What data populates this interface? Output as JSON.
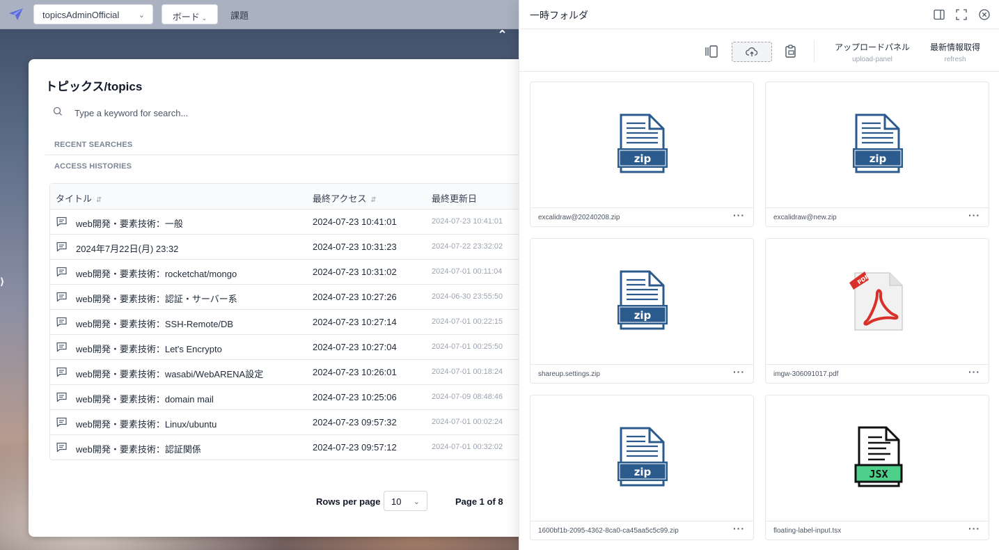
{
  "topbar": {
    "workspace": "topicsAdminOfficial",
    "board_label": "ボード",
    "task_label": "課題"
  },
  "topics": {
    "title": "トピックス/topics",
    "search_placeholder": "Type a keyword for search...",
    "recent_searches": "RECENT SEARCHES",
    "access_histories": "ACCESS HISTORIES",
    "columns": {
      "title": "タイトル",
      "last_access": "最終アクセス",
      "last_updated": "最終更新日"
    },
    "rows": [
      {
        "title": "web開発・要素技術：一般",
        "access": "2024-07-23 10:41:01",
        "updated": "2024-07-23 10:41:01"
      },
      {
        "title": "2024年7月22日(月) 23:32",
        "access": "2024-07-23 10:31:23",
        "updated": "2024-07-22 23:32:02"
      },
      {
        "title": "web開発・要素技術：rocketchat/mongo",
        "access": "2024-07-23 10:31:02",
        "updated": "2024-07-01 00:11:04"
      },
      {
        "title": "web開発・要素技術：認証・サーバー系",
        "access": "2024-07-23 10:27:26",
        "updated": "2024-06-30 23:55:50"
      },
      {
        "title": "web開発・要素技術：SSH-Remote/DB",
        "access": "2024-07-23 10:27:14",
        "updated": "2024-07-01 00:22:15"
      },
      {
        "title": "web開発・要素技術：Let's Encrypto",
        "access": "2024-07-23 10:27:04",
        "updated": "2024-07-01 00:25:50"
      },
      {
        "title": "web開発・要素技術：wasabi/WebARENA設定",
        "access": "2024-07-23 10:26:01",
        "updated": "2024-07-01 00:18:24"
      },
      {
        "title": "web開発・要素技術：domain mail",
        "access": "2024-07-23 10:25:06",
        "updated": "2024-07-09 08:48:46"
      },
      {
        "title": "web開発・要素技術：Linux/ubuntu",
        "access": "2024-07-23 09:57:32",
        "updated": "2024-07-01 00:02:24"
      },
      {
        "title": "web開発・要素技術：認証関係",
        "access": "2024-07-23 09:57:12",
        "updated": "2024-07-01 00:32:02"
      }
    ],
    "rows_per_page_label": "Rows per page",
    "rows_per_page": "10",
    "page_info": "Page 1 of 8"
  },
  "drawer": {
    "title": "一時フォルダ",
    "upload_panel": {
      "label": "アップロードパネル",
      "sub": "upload-panel"
    },
    "refresh": {
      "label": "最新情報取得",
      "sub": "refresh"
    },
    "files": [
      {
        "name": "excalidraw@20240208.zip",
        "type": "zip",
        "badge": "zip"
      },
      {
        "name": "excalidraw@new.zip",
        "type": "zip",
        "badge": "zip"
      },
      {
        "name": "shareup.settings.zip",
        "type": "zip",
        "badge": "zip"
      },
      {
        "name": "imgw-306091017.pdf",
        "type": "pdf",
        "badge": "PDF"
      },
      {
        "name": "1600bf1b-2095-4362-8ca0-ca45aa5c5c99.zip",
        "type": "zip",
        "badge": "zip"
      },
      {
        "name": "floating-label-input.tsx",
        "type": "jsx",
        "badge": "JSX"
      }
    ],
    "more_label": "···"
  },
  "colors": {
    "zip_blue": "#2b5b8c",
    "jsx_green": "#4fd08a",
    "pdf_red": "#d8312a"
  }
}
